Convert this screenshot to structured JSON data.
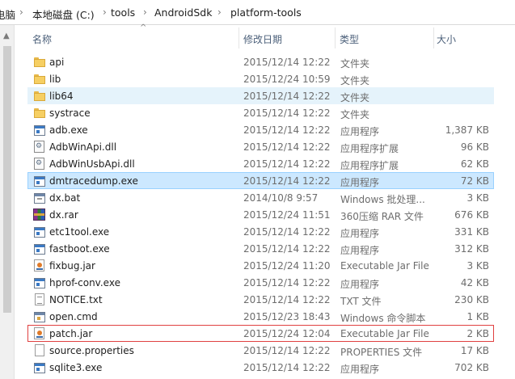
{
  "breadcrumb": [
    "电脑",
    "本地磁盘 (C:)",
    "tools",
    "AndroidSdk",
    "platform-tools"
  ],
  "breadcrumb_separator": "›",
  "columns": {
    "name": "名称",
    "date": "修改日期",
    "type": "类型",
    "size": "大小"
  },
  "files": [
    {
      "name": "api",
      "date": "2015/12/14 12:22",
      "type": "文件夹",
      "size": "",
      "icon": "folder-icon"
    },
    {
      "name": "lib",
      "date": "2015/12/24 10:59",
      "type": "文件夹",
      "size": "",
      "icon": "folder-icon"
    },
    {
      "name": "lib64",
      "date": "2015/12/14 12:22",
      "type": "文件夹",
      "size": "",
      "icon": "folder-icon"
    },
    {
      "name": "systrace",
      "date": "2015/12/14 12:22",
      "type": "文件夹",
      "size": "",
      "icon": "folder-icon"
    },
    {
      "name": "adb.exe",
      "date": "2015/12/14 12:22",
      "type": "应用程序",
      "size": "1,387 KB",
      "icon": "exe-icon"
    },
    {
      "name": "AdbWinApi.dll",
      "date": "2015/12/14 12:22",
      "type": "应用程序扩展",
      "size": "96 KB",
      "icon": "dll-icon"
    },
    {
      "name": "AdbWinUsbApi.dll",
      "date": "2015/12/14 12:22",
      "type": "应用程序扩展",
      "size": "62 KB",
      "icon": "dll-icon"
    },
    {
      "name": "dmtracedump.exe",
      "date": "2015/12/14 12:22",
      "type": "应用程序",
      "size": "72 KB",
      "icon": "exe-icon"
    },
    {
      "name": "dx.bat",
      "date": "2014/10/8 9:57",
      "type": "Windows 批处理...",
      "size": "3 KB",
      "icon": "batch-icon"
    },
    {
      "name": "dx.rar",
      "date": "2015/12/24 11:51",
      "type": "360压缩 RAR 文件",
      "size": "676 KB",
      "icon": "rar-icon"
    },
    {
      "name": "etc1tool.exe",
      "date": "2015/12/14 12:22",
      "type": "应用程序",
      "size": "331 KB",
      "icon": "exe-icon"
    },
    {
      "name": "fastboot.exe",
      "date": "2015/12/14 12:22",
      "type": "应用程序",
      "size": "312 KB",
      "icon": "exe-icon"
    },
    {
      "name": "fixbug.jar",
      "date": "2015/12/24 11:20",
      "type": "Executable Jar File",
      "size": "3 KB",
      "icon": "jar-icon"
    },
    {
      "name": "hprof-conv.exe",
      "date": "2015/12/14 12:22",
      "type": "应用程序",
      "size": "42 KB",
      "icon": "exe-icon"
    },
    {
      "name": "NOTICE.txt",
      "date": "2015/12/14 12:22",
      "type": "TXT 文件",
      "size": "230 KB",
      "icon": "text-file-icon"
    },
    {
      "name": "open.cmd",
      "date": "2015/12/23 18:43",
      "type": "Windows 命令脚本",
      "size": "1 KB",
      "icon": "cmd-icon"
    },
    {
      "name": "patch.jar",
      "date": "2015/12/24 12:04",
      "type": "Executable Jar File",
      "size": "2 KB",
      "icon": "jar-icon"
    },
    {
      "name": "source.properties",
      "date": "2015/12/14 12:22",
      "type": "PROPERTIES 文件",
      "size": "17 KB",
      "icon": "document-icon"
    },
    {
      "name": "sqlite3.exe",
      "date": "2015/12/14 12:22",
      "type": "应用程序",
      "size": "702 KB",
      "icon": "exe-icon"
    }
  ],
  "hovered_file": "lib64",
  "selected_file": "dmtracedump.exe",
  "highlighted_file": "patch.jar",
  "colors": {
    "header_text": "#4c607a",
    "hover_bg": "#e5f3fb",
    "selected_bg": "#cce8ff",
    "selected_border": "#99d1ff",
    "highlight_border": "#e04040"
  }
}
